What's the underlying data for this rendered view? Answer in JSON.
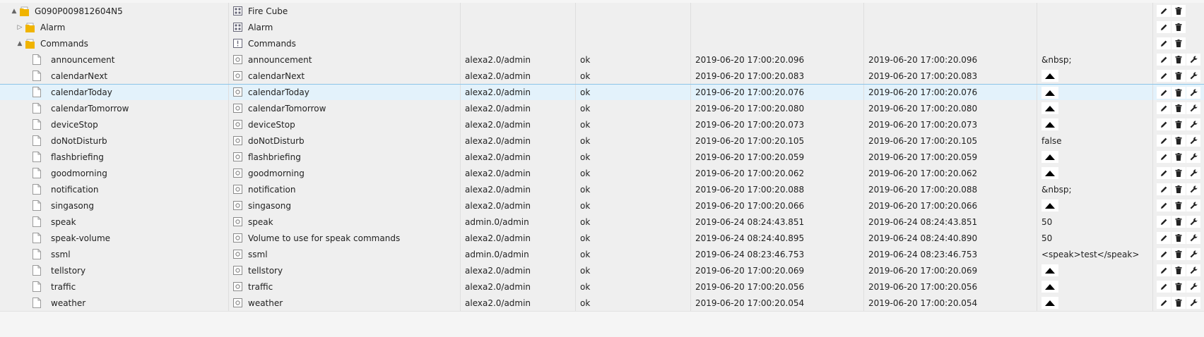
{
  "rows": [
    {
      "indent": 1,
      "toggle": "▲",
      "kind": "folder",
      "id": "G090P009812604N5",
      "type_icon": "device-icon",
      "name": "Fire Cube",
      "from": "",
      "ack": "",
      "ts": "",
      "lc": "",
      "value": "",
      "value_kind": "none",
      "actions": 2
    },
    {
      "indent": 2,
      "toggle": "▷",
      "kind": "folder",
      "id": "Alarm",
      "type_icon": "channel-icon",
      "name": "Alarm",
      "from": "",
      "ack": "",
      "ts": "",
      "lc": "",
      "value": "",
      "value_kind": "none",
      "actions": 2
    },
    {
      "indent": 2,
      "toggle": "▲",
      "kind": "folder",
      "id": "Commands",
      "type_icon": "info-icon",
      "name": "Commands",
      "from": "",
      "ack": "",
      "ts": "",
      "lc": "",
      "value": "",
      "value_kind": "none",
      "actions": 2
    },
    {
      "indent": 3,
      "toggle": "",
      "kind": "file",
      "id": "announcement",
      "type_icon": "state-icon",
      "name": "announcement",
      "from": "alexa2.0/admin",
      "ack": "ok",
      "ts": "2019-06-20 17:00:20.096",
      "lc": "2019-06-20 17:00:20.096",
      "value": "&nbsp;",
      "value_kind": "text",
      "actions": 3
    },
    {
      "indent": 3,
      "toggle": "",
      "kind": "file",
      "id": "calendarNext",
      "type_icon": "state-icon",
      "name": "calendarNext",
      "from": "alexa2.0/admin",
      "ack": "ok",
      "ts": "2019-06-20 17:00:20.083",
      "lc": "2019-06-20 17:00:20.083",
      "value": "",
      "value_kind": "button",
      "actions": 3
    },
    {
      "indent": 3,
      "toggle": "",
      "kind": "file",
      "id": "calendarToday",
      "type_icon": "state-icon",
      "name": "calendarToday",
      "from": "alexa2.0/admin",
      "ack": "ok",
      "ts": "2019-06-20 17:00:20.076",
      "lc": "2019-06-20 17:00:20.076",
      "value": "",
      "value_kind": "button",
      "actions": 3,
      "selected": true
    },
    {
      "indent": 3,
      "toggle": "",
      "kind": "file",
      "id": "calendarTomorrow",
      "type_icon": "state-icon",
      "name": "calendarTomorrow",
      "from": "alexa2.0/admin",
      "ack": "ok",
      "ts": "2019-06-20 17:00:20.080",
      "lc": "2019-06-20 17:00:20.080",
      "value": "",
      "value_kind": "button",
      "actions": 3
    },
    {
      "indent": 3,
      "toggle": "",
      "kind": "file",
      "id": "deviceStop",
      "type_icon": "state-icon",
      "name": "deviceStop",
      "from": "alexa2.0/admin",
      "ack": "ok",
      "ts": "2019-06-20 17:00:20.073",
      "lc": "2019-06-20 17:00:20.073",
      "value": "",
      "value_kind": "button",
      "actions": 3
    },
    {
      "indent": 3,
      "toggle": "",
      "kind": "file",
      "id": "doNotDisturb",
      "type_icon": "state-icon",
      "name": "doNotDisturb",
      "from": "alexa2.0/admin",
      "ack": "ok",
      "ts": "2019-06-20 17:00:20.105",
      "lc": "2019-06-20 17:00:20.105",
      "value": "false",
      "value_kind": "text",
      "actions": 3
    },
    {
      "indent": 3,
      "toggle": "",
      "kind": "file",
      "id": "flashbriefing",
      "type_icon": "state-icon",
      "name": "flashbriefing",
      "from": "alexa2.0/admin",
      "ack": "ok",
      "ts": "2019-06-20 17:00:20.059",
      "lc": "2019-06-20 17:00:20.059",
      "value": "",
      "value_kind": "button",
      "actions": 3
    },
    {
      "indent": 3,
      "toggle": "",
      "kind": "file",
      "id": "goodmorning",
      "type_icon": "state-icon",
      "name": "goodmorning",
      "from": "alexa2.0/admin",
      "ack": "ok",
      "ts": "2019-06-20 17:00:20.062",
      "lc": "2019-06-20 17:00:20.062",
      "value": "",
      "value_kind": "button",
      "actions": 3
    },
    {
      "indent": 3,
      "toggle": "",
      "kind": "file",
      "id": "notification",
      "type_icon": "state-icon",
      "name": "notification",
      "from": "alexa2.0/admin",
      "ack": "ok",
      "ts": "2019-06-20 17:00:20.088",
      "lc": "2019-06-20 17:00:20.088",
      "value": "&nbsp;",
      "value_kind": "text",
      "actions": 3
    },
    {
      "indent": 3,
      "toggle": "",
      "kind": "file",
      "id": "singasong",
      "type_icon": "state-icon",
      "name": "singasong",
      "from": "alexa2.0/admin",
      "ack": "ok",
      "ts": "2019-06-20 17:00:20.066",
      "lc": "2019-06-20 17:00:20.066",
      "value": "",
      "value_kind": "button",
      "actions": 3
    },
    {
      "indent": 3,
      "toggle": "",
      "kind": "file",
      "id": "speak",
      "type_icon": "state-icon",
      "name": "speak",
      "from": "admin.0/admin",
      "ack": "ok",
      "ts": "2019-06-24 08:24:43.851",
      "lc": "2019-06-24 08:24:43.851",
      "value": "50",
      "value_kind": "text",
      "actions": 3
    },
    {
      "indent": 3,
      "toggle": "",
      "kind": "file",
      "id": "speak-volume",
      "type_icon": "state-icon",
      "name": "Volume to use for speak commands",
      "from": "alexa2.0/admin",
      "ack": "ok",
      "ts": "2019-06-24 08:24:40.895",
      "lc": "2019-06-24 08:24:40.890",
      "value": "50",
      "value_kind": "text",
      "actions": 3
    },
    {
      "indent": 3,
      "toggle": "",
      "kind": "file",
      "id": "ssml",
      "type_icon": "state-icon",
      "name": "ssml",
      "from": "admin.0/admin",
      "ack": "ok",
      "ts": "2019-06-24 08:23:46.753",
      "lc": "2019-06-24 08:23:46.753",
      "value": "<speak>test</speak>",
      "value_kind": "text",
      "actions": 3
    },
    {
      "indent": 3,
      "toggle": "",
      "kind": "file",
      "id": "tellstory",
      "type_icon": "state-icon",
      "name": "tellstory",
      "from": "alexa2.0/admin",
      "ack": "ok",
      "ts": "2019-06-20 17:00:20.069",
      "lc": "2019-06-20 17:00:20.069",
      "value": "",
      "value_kind": "button",
      "actions": 3
    },
    {
      "indent": 3,
      "toggle": "",
      "kind": "file",
      "id": "traffic",
      "type_icon": "state-icon",
      "name": "traffic",
      "from": "alexa2.0/admin",
      "ack": "ok",
      "ts": "2019-06-20 17:00:20.056",
      "lc": "2019-06-20 17:00:20.056",
      "value": "",
      "value_kind": "button",
      "actions": 3
    },
    {
      "indent": 3,
      "toggle": "",
      "kind": "file",
      "id": "weather",
      "type_icon": "state-icon",
      "name": "weather",
      "from": "alexa2.0/admin",
      "ack": "ok",
      "ts": "2019-06-20 17:00:20.054",
      "lc": "2019-06-20 17:00:20.054",
      "value": "",
      "value_kind": "button",
      "actions": 3
    }
  ],
  "action_icons": [
    "pencil-icon",
    "trash-icon",
    "wrench-icon"
  ],
  "colors": {
    "folder": "#f0b400",
    "row_bg": "#efefef",
    "selected_bg": "#e3f2fb",
    "selected_border": "#8cc4e8"
  }
}
